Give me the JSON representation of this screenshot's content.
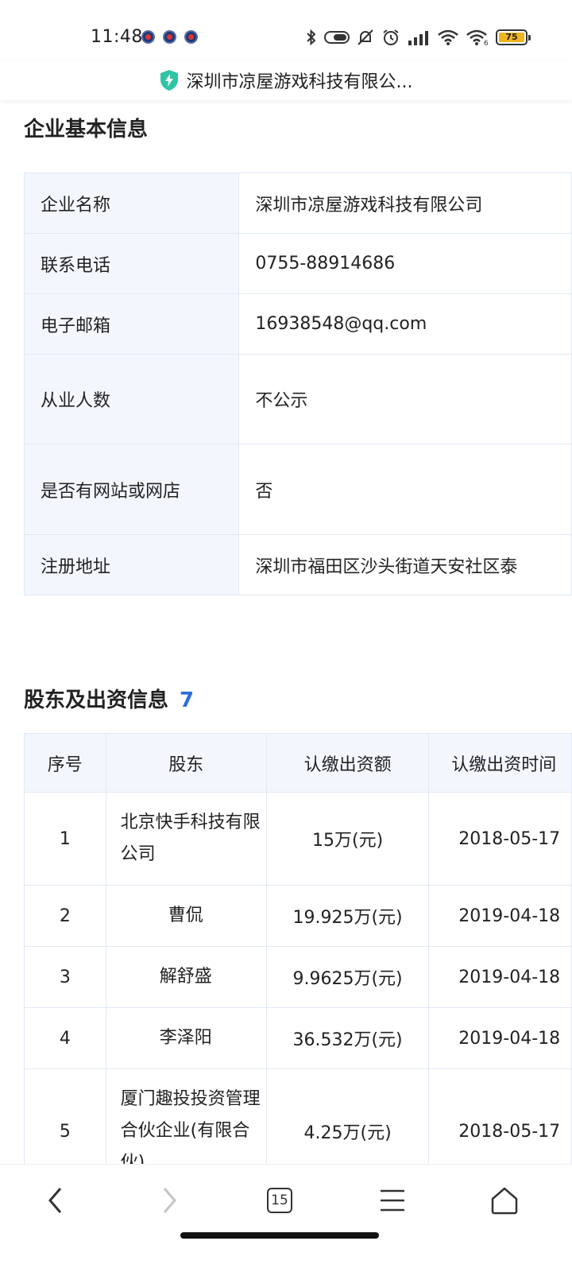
{
  "status_bar": {
    "time": "11:48",
    "battery": "75",
    "icons": [
      "notification-icon",
      "notification-icon",
      "notification-icon",
      "bluetooth-icon",
      "toggle-icon",
      "mute-icon",
      "alarm-icon",
      "signal-icon",
      "wifi-icon",
      "wifi-icon",
      "battery-icon"
    ]
  },
  "title_bar": {
    "title": "深圳市凉屋游戏科技有限公...",
    "icon": "shield-lightning-icon"
  },
  "basic_info": {
    "heading": "企业基本信息",
    "rows": [
      {
        "key": "企业名称",
        "value": "深圳市凉屋游戏科技有限公司"
      },
      {
        "key": "联系电话",
        "value": "0755-88914686"
      },
      {
        "key": "电子邮箱",
        "value": "16938548@qq.com"
      },
      {
        "key": "从业人数",
        "value": "不公示"
      },
      {
        "key": "是否有网站或网店",
        "value": "否"
      },
      {
        "key": "注册地址",
        "value": "深圳市福田区沙头街道天安社区泰"
      }
    ]
  },
  "shareholders": {
    "heading": "股东及出资信息",
    "count": "7",
    "columns": [
      "序号",
      "股东",
      "认缴出资额",
      "认缴出资时间"
    ],
    "rows": [
      {
        "index": "1",
        "name": "北京快手科技有限公司",
        "amount": "15万(元)",
        "date": "2018-05-17"
      },
      {
        "index": "2",
        "name": "曹侃",
        "amount": "19.925万(元)",
        "date": "2019-04-18"
      },
      {
        "index": "3",
        "name": "解舒盛",
        "amount": "9.9625万(元)",
        "date": "2019-04-18"
      },
      {
        "index": "4",
        "name": "李泽阳",
        "amount": "36.532万(元)",
        "date": "2019-04-18"
      },
      {
        "index": "5",
        "name": "厦门趣投投资管理合伙企业(有限合伙)",
        "amount": "4.25万(元)",
        "date": "2018-05-17"
      }
    ]
  },
  "bottom_nav": {
    "tab_count": "15"
  },
  "colors": {
    "accent": "#2d6fd8",
    "header_bg": "#f3f7fd",
    "border": "#e1e9f4",
    "shield": "#2ec4a4"
  }
}
